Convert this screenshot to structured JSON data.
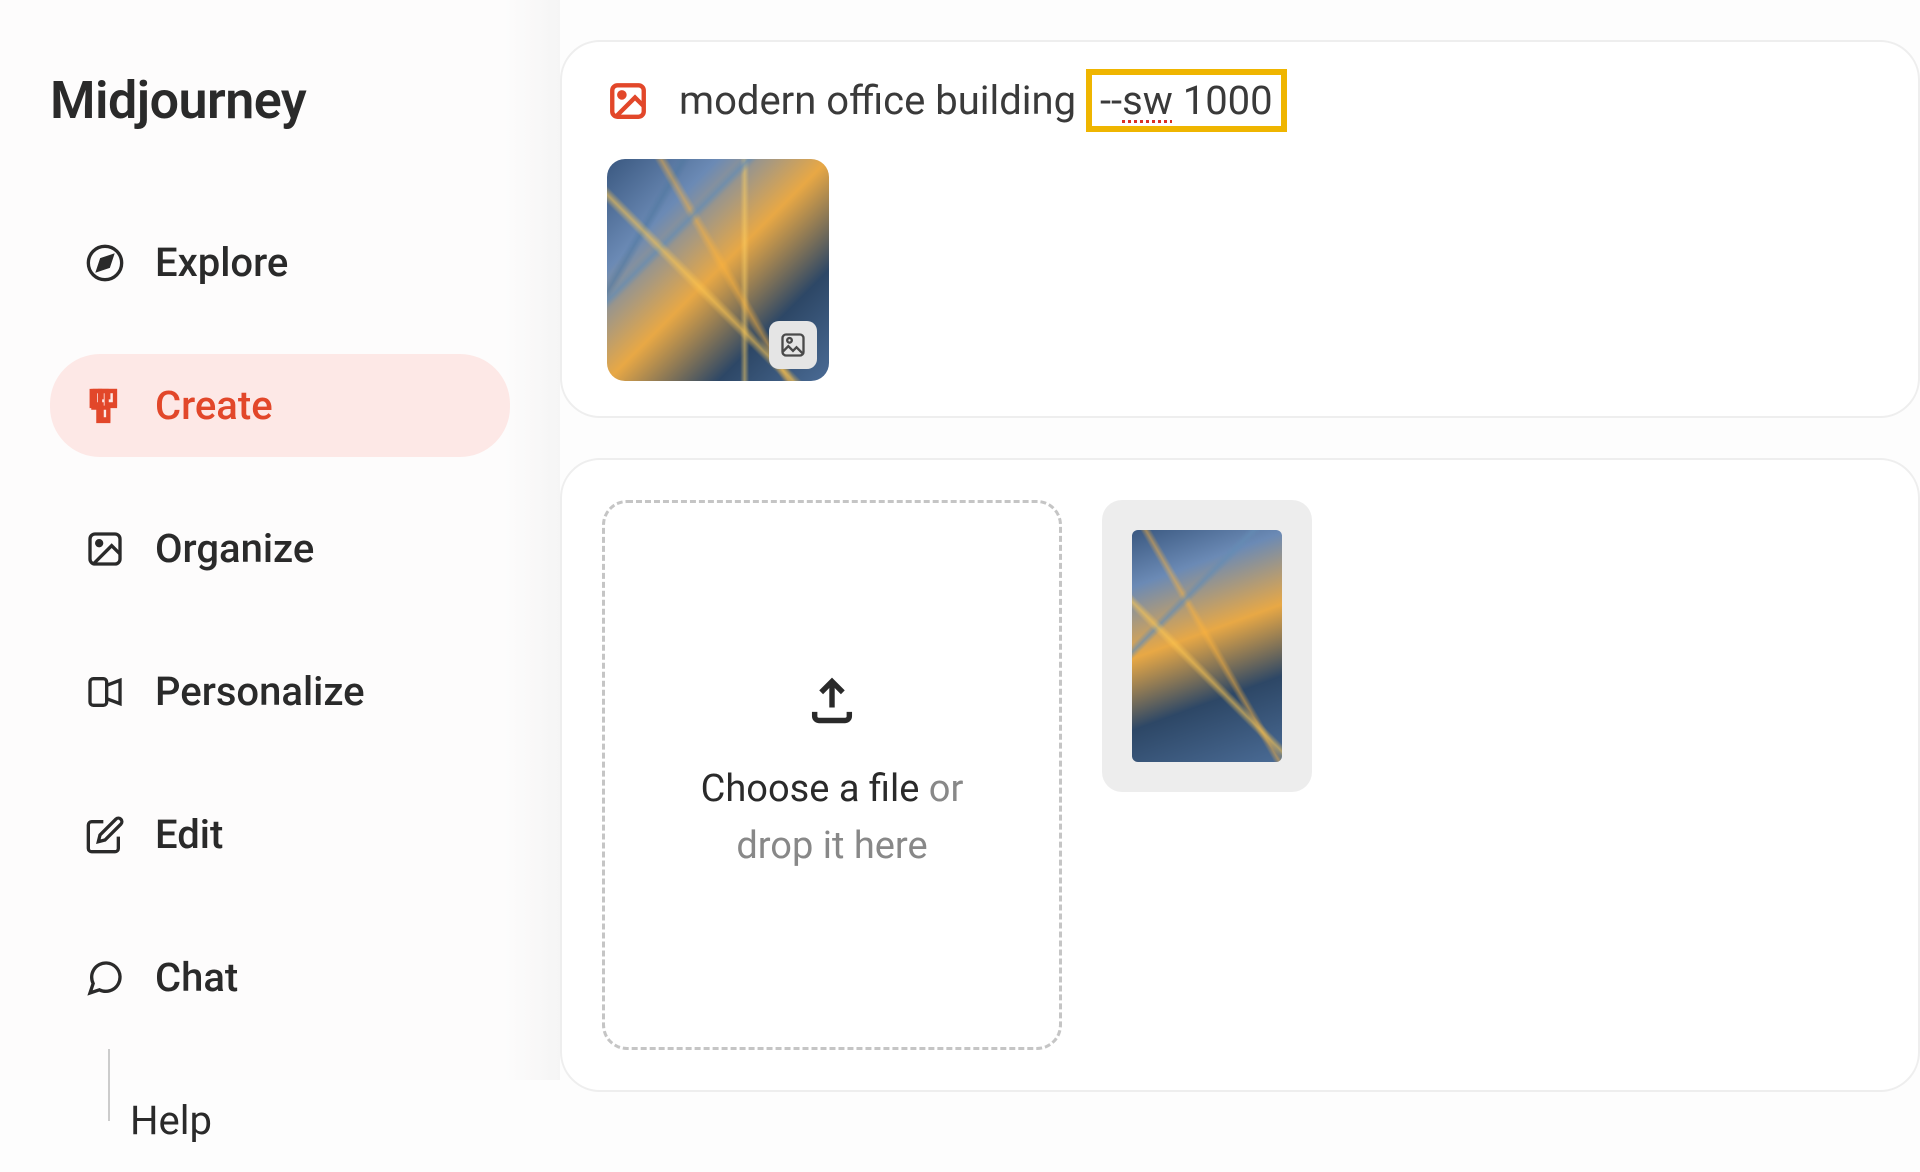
{
  "app": {
    "name": "Midjourney"
  },
  "sidebar": {
    "items": [
      {
        "label": "Explore",
        "icon": "compass"
      },
      {
        "label": "Create",
        "icon": "brush",
        "active": true
      },
      {
        "label": "Organize",
        "icon": "image"
      },
      {
        "label": "Personalize",
        "icon": "shapes"
      },
      {
        "label": "Edit",
        "icon": "pencil-square"
      },
      {
        "label": "Chat",
        "icon": "chat-bubbles"
      }
    ],
    "subitems": [
      {
        "label": "Help"
      }
    ]
  },
  "prompt": {
    "text_prefix": "modern office building ",
    "highlighted_param": "--sw 1000",
    "highlighted_underlined": "sw"
  },
  "dropzone": {
    "text_main": "Choose a file",
    "text_or": " or",
    "text_drop": "drop it here"
  },
  "annotation": {
    "highlight_color": "#efb500",
    "arrow_color": "#f5a623"
  }
}
